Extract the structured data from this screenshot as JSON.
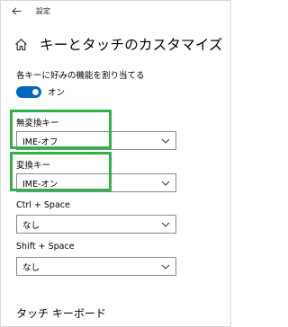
{
  "titlebar": {
    "back_label": "←",
    "app_title": "設定"
  },
  "page": {
    "title": "キーとタッチのカスタマイズ"
  },
  "assign": {
    "label": "各キーに好みの機能を割り当てる",
    "toggle_state": "オン",
    "toggle_on": true
  },
  "settings": [
    {
      "label": "無変換キー",
      "value": "IME-オフ"
    },
    {
      "label": "変換キー",
      "value": "IME-オン"
    },
    {
      "label": "Ctrl + Space",
      "value": "なし"
    },
    {
      "label": "Shift + Space",
      "value": "なし"
    }
  ],
  "touch_keyboard": {
    "title": "タッチ キーボード"
  },
  "colors": {
    "accent": "#0067c0",
    "highlight": "#2db34a"
  }
}
